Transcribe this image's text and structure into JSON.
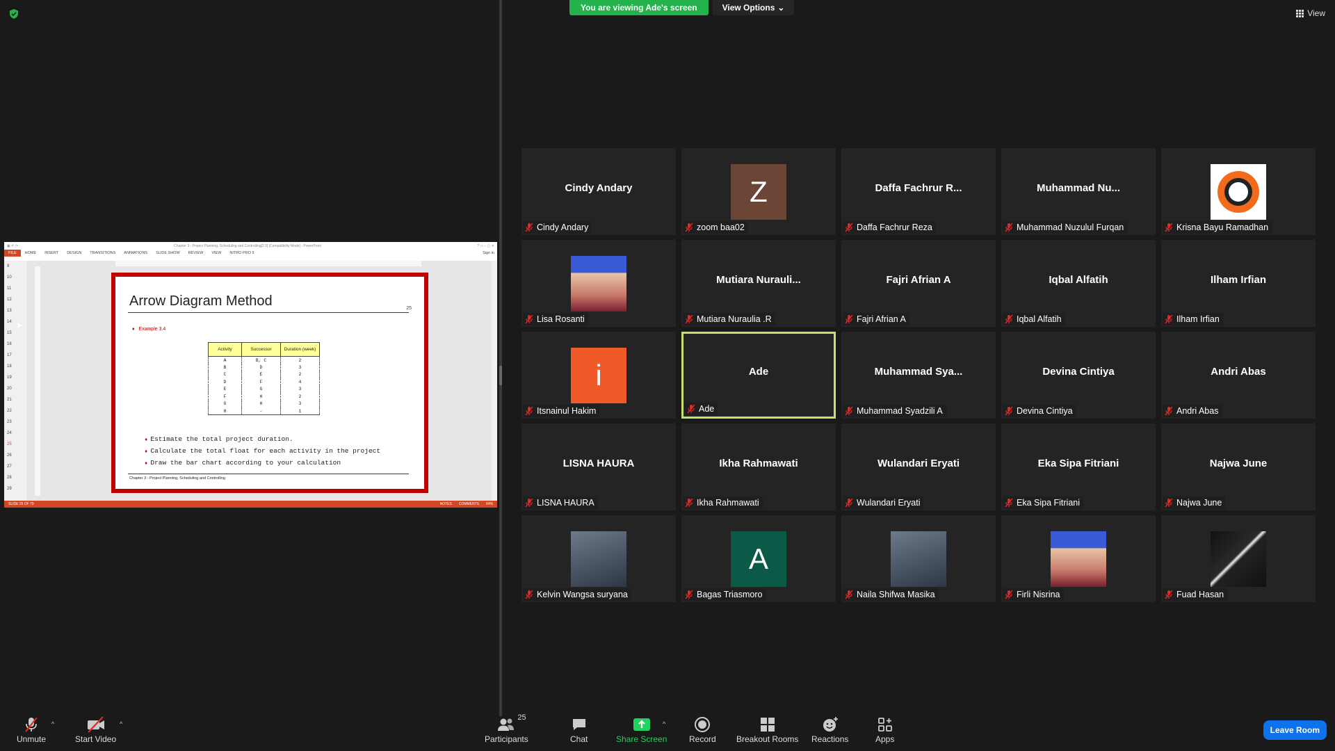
{
  "top_bar": {
    "viewing_banner": "You are viewing Ade's screen",
    "view_options": "View Options",
    "view_button": "View"
  },
  "shared_screen": {
    "window_title": "Chapter 3 - Project Planning, Scheduling and Controlling[2.0] [Compatibility Mode] - PowerPoint",
    "ribbon_tabs": [
      "FILE",
      "HOME",
      "INSERT",
      "DESIGN",
      "TRANSITIONS",
      "ANIMATIONS",
      "SLIDE SHOW",
      "REVIEW",
      "VIEW",
      "NITRO PRO 9"
    ],
    "sign_in": "Sign in",
    "thumb_numbers": [
      "9",
      "10",
      "11",
      "12",
      "13",
      "14",
      "15",
      "16",
      "17",
      "18",
      "19",
      "20",
      "21",
      "22",
      "23",
      "24",
      "25",
      "26",
      "27",
      "28",
      "29"
    ],
    "slide": {
      "title": "Arrow Diagram Method",
      "number": "25",
      "example": "Example 3.4",
      "table_headers": [
        "Activity",
        "Successor",
        "Duration (week)"
      ],
      "table_rows": [
        [
          "A",
          "B, C",
          "2"
        ],
        [
          "B",
          "D",
          "3"
        ],
        [
          "C",
          "E",
          "2"
        ],
        [
          "D",
          "F",
          "4"
        ],
        [
          "E",
          "G",
          "3"
        ],
        [
          "F",
          "H",
          "2"
        ],
        [
          "G",
          "H",
          "3"
        ],
        [
          "H",
          "-",
          "1"
        ]
      ],
      "bullets": [
        "Estimate the total project duration.",
        "Calculate the total float for each activity in the project",
        "Draw the bar chart according to your calculation"
      ],
      "footer": "Chapter 3 - Project Planning, Scheduling and Controlling"
    },
    "status_left": "SLIDE 25 OF 79",
    "status_notes": "NOTES",
    "status_comments": "COMMENTS",
    "zoom": "64%"
  },
  "participants": [
    {
      "display": "Cindy Andary",
      "label": "Cindy Andary"
    },
    {
      "display": "",
      "avatar": "Z",
      "avatar_color": "#6b4535",
      "label": "zoom baa02"
    },
    {
      "display": "Daffa Fachrur R...",
      "label": "Daffa Fachrur Reza"
    },
    {
      "display": "Muhammad  Nu...",
      "label": "Muhammad Nuzulul Furqan"
    },
    {
      "display": "",
      "photo": "under-construction-logo",
      "label": "Krisna Bayu Ramadhan"
    },
    {
      "display": "",
      "photo": "portrait",
      "label": "Lisa Rosanti"
    },
    {
      "display": "Mutiara  Nurauli...",
      "label": "Mutiara Nuraulia .R"
    },
    {
      "display": "Fajri Afrian A",
      "label": "Fajri Afrian A"
    },
    {
      "display": "Iqbal Alfatih",
      "label": "Iqbal Alfatih"
    },
    {
      "display": "Ilham Irfian",
      "label": "Ilham Irfian"
    },
    {
      "display": "",
      "avatar": "i",
      "avatar_color": "#f05a28",
      "label": "Itsnainul Hakim"
    },
    {
      "display": "Ade",
      "label": "Ade",
      "active": true
    },
    {
      "display": "Muhammad  Sya...",
      "label": "Muhammad Syadzili A"
    },
    {
      "display": "Devina Cintiya",
      "label": "Devina Cintiya"
    },
    {
      "display": "Andri Abas",
      "label": "Andri Abas"
    },
    {
      "display": "LISNA HAURA",
      "label": "LISNA HAURA"
    },
    {
      "display": "Ikha Rahmawati",
      "label": "Ikha Rahmawati"
    },
    {
      "display": "Wulandari Eryati",
      "label": "Wulandari Eryati"
    },
    {
      "display": "Eka Sipa Fitriani",
      "label": "Eka Sipa Fitriani"
    },
    {
      "display": "Najwa June",
      "label": "Najwa June"
    },
    {
      "display": "",
      "photo": "person-photo",
      "label": "Kelvin Wangsa suryana"
    },
    {
      "display": "",
      "avatar": "A",
      "avatar_color": "#0b5a48",
      "label": "Bagas Triasmoro"
    },
    {
      "display": "",
      "photo": "person-photo",
      "label": "Naila Shifwa Masika"
    },
    {
      "display": "",
      "photo": "portrait",
      "label": "Firli Nisrina"
    },
    {
      "display": "",
      "photo": "dark-texture",
      "label": "Fuad Hasan"
    }
  ],
  "toolbar": {
    "unmute": "Unmute",
    "start_video": "Start Video",
    "participants": "Participants",
    "participant_count": "25",
    "chat": "Chat",
    "share_screen": "Share Screen",
    "record": "Record",
    "breakout_rooms": "Breakout Rooms",
    "reactions": "Reactions",
    "apps": "Apps",
    "leave_room": "Leave Room"
  },
  "colors": {
    "green_accent": "#23b24b",
    "leave_blue": "#0e72ed",
    "active_speaker": "#c6e06a",
    "mic_muted_red": "#e02828"
  }
}
